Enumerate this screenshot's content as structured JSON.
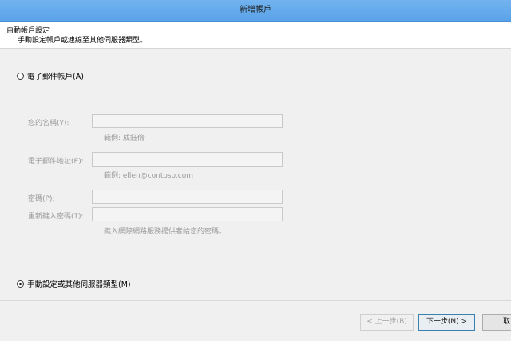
{
  "window": {
    "title": "新增帳戶"
  },
  "header": {
    "title": "自動帳戶設定",
    "subtitle": "手動設定帳戶或連線至其他伺服器類型。"
  },
  "options": {
    "email_account": {
      "label": "電子郵件帳戶(A)",
      "selected": false
    },
    "manual_setup": {
      "label": "手動設定或其他伺服器類型(M)",
      "selected": true
    }
  },
  "form": {
    "name": {
      "label": "您的名稱(Y):",
      "value": "",
      "hint": "範例: 成鈺倫"
    },
    "email": {
      "label": "電子郵件地址(E):",
      "value": "",
      "hint": "範例: ellen@contoso.com"
    },
    "password": {
      "label": "密碼(P):",
      "value": ""
    },
    "password_confirm": {
      "label": "重新鍵入密碼(T):",
      "value": "",
      "hint": "鍵入網際網路服務提供者給您的密碼。"
    }
  },
  "buttons": {
    "back": "< 上一步(B)",
    "next": "下一步(N) >",
    "cancel": "取"
  }
}
